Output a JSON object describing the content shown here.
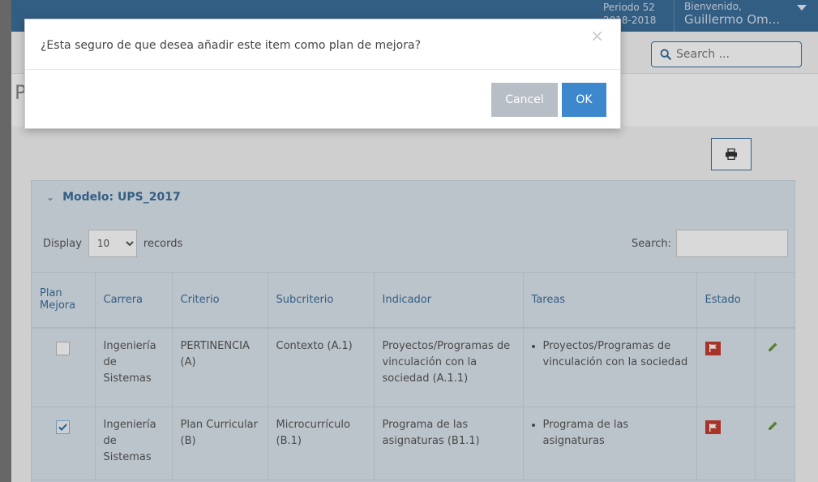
{
  "topbar": {
    "period_label": "Periodo 52",
    "period_value": "2018-2018",
    "welcome_label": "Bienvenido,",
    "user_name": "Guillermo Om..."
  },
  "search": {
    "placeholder": "Search ..."
  },
  "page": {
    "title_letter": "P"
  },
  "panel": {
    "title": "Modelo: UPS_2017",
    "display_label": "Display",
    "records_label": "records",
    "page_size": "10",
    "search_label": "Search:"
  },
  "table": {
    "headers": [
      "Plan Mejora",
      "Carrera",
      "Criterio",
      "Subcriterio",
      "Indicador",
      "Tareas",
      "Estado",
      ""
    ],
    "rows": [
      {
        "checked": false,
        "carrera": "Ingeniería de Sistemas",
        "criterio": "PERTINENCIA (A)",
        "subcriterio": "Contexto (A.1)",
        "indicador": "Proyectos/Programas de vinculación con la sociedad (A.1.1)",
        "tarea": "Proyectos/Programas de vinculación con la sociedad"
      },
      {
        "checked": true,
        "carrera": "Ingeniería de Sistemas",
        "criterio": "Plan Curricular (B)",
        "subcriterio": "Microcurrículo (B.1)",
        "indicador": "Programa de las asignaturas (B1.1)",
        "tarea": "Programa de las asignaturas"
      }
    ]
  },
  "modal": {
    "message": "¿Esta seguro de que desea añadir este item como plan de mejora?",
    "close": "×",
    "cancel_label": "Cancel",
    "ok_label": "OK"
  },
  "colors": {
    "topbar": "#3c6f9c",
    "accent": "#3c6f9c",
    "ok_button": "#3d88cc",
    "cancel_button": "#b7bec6",
    "flag": "#c63d2f",
    "pencil": "#6a9a3a"
  },
  "icons": [
    "search-icon",
    "print-icon",
    "chevron-down-icon",
    "checkbox-icon",
    "flag-icon",
    "pencil-icon",
    "close-icon",
    "caret-down-icon"
  ]
}
